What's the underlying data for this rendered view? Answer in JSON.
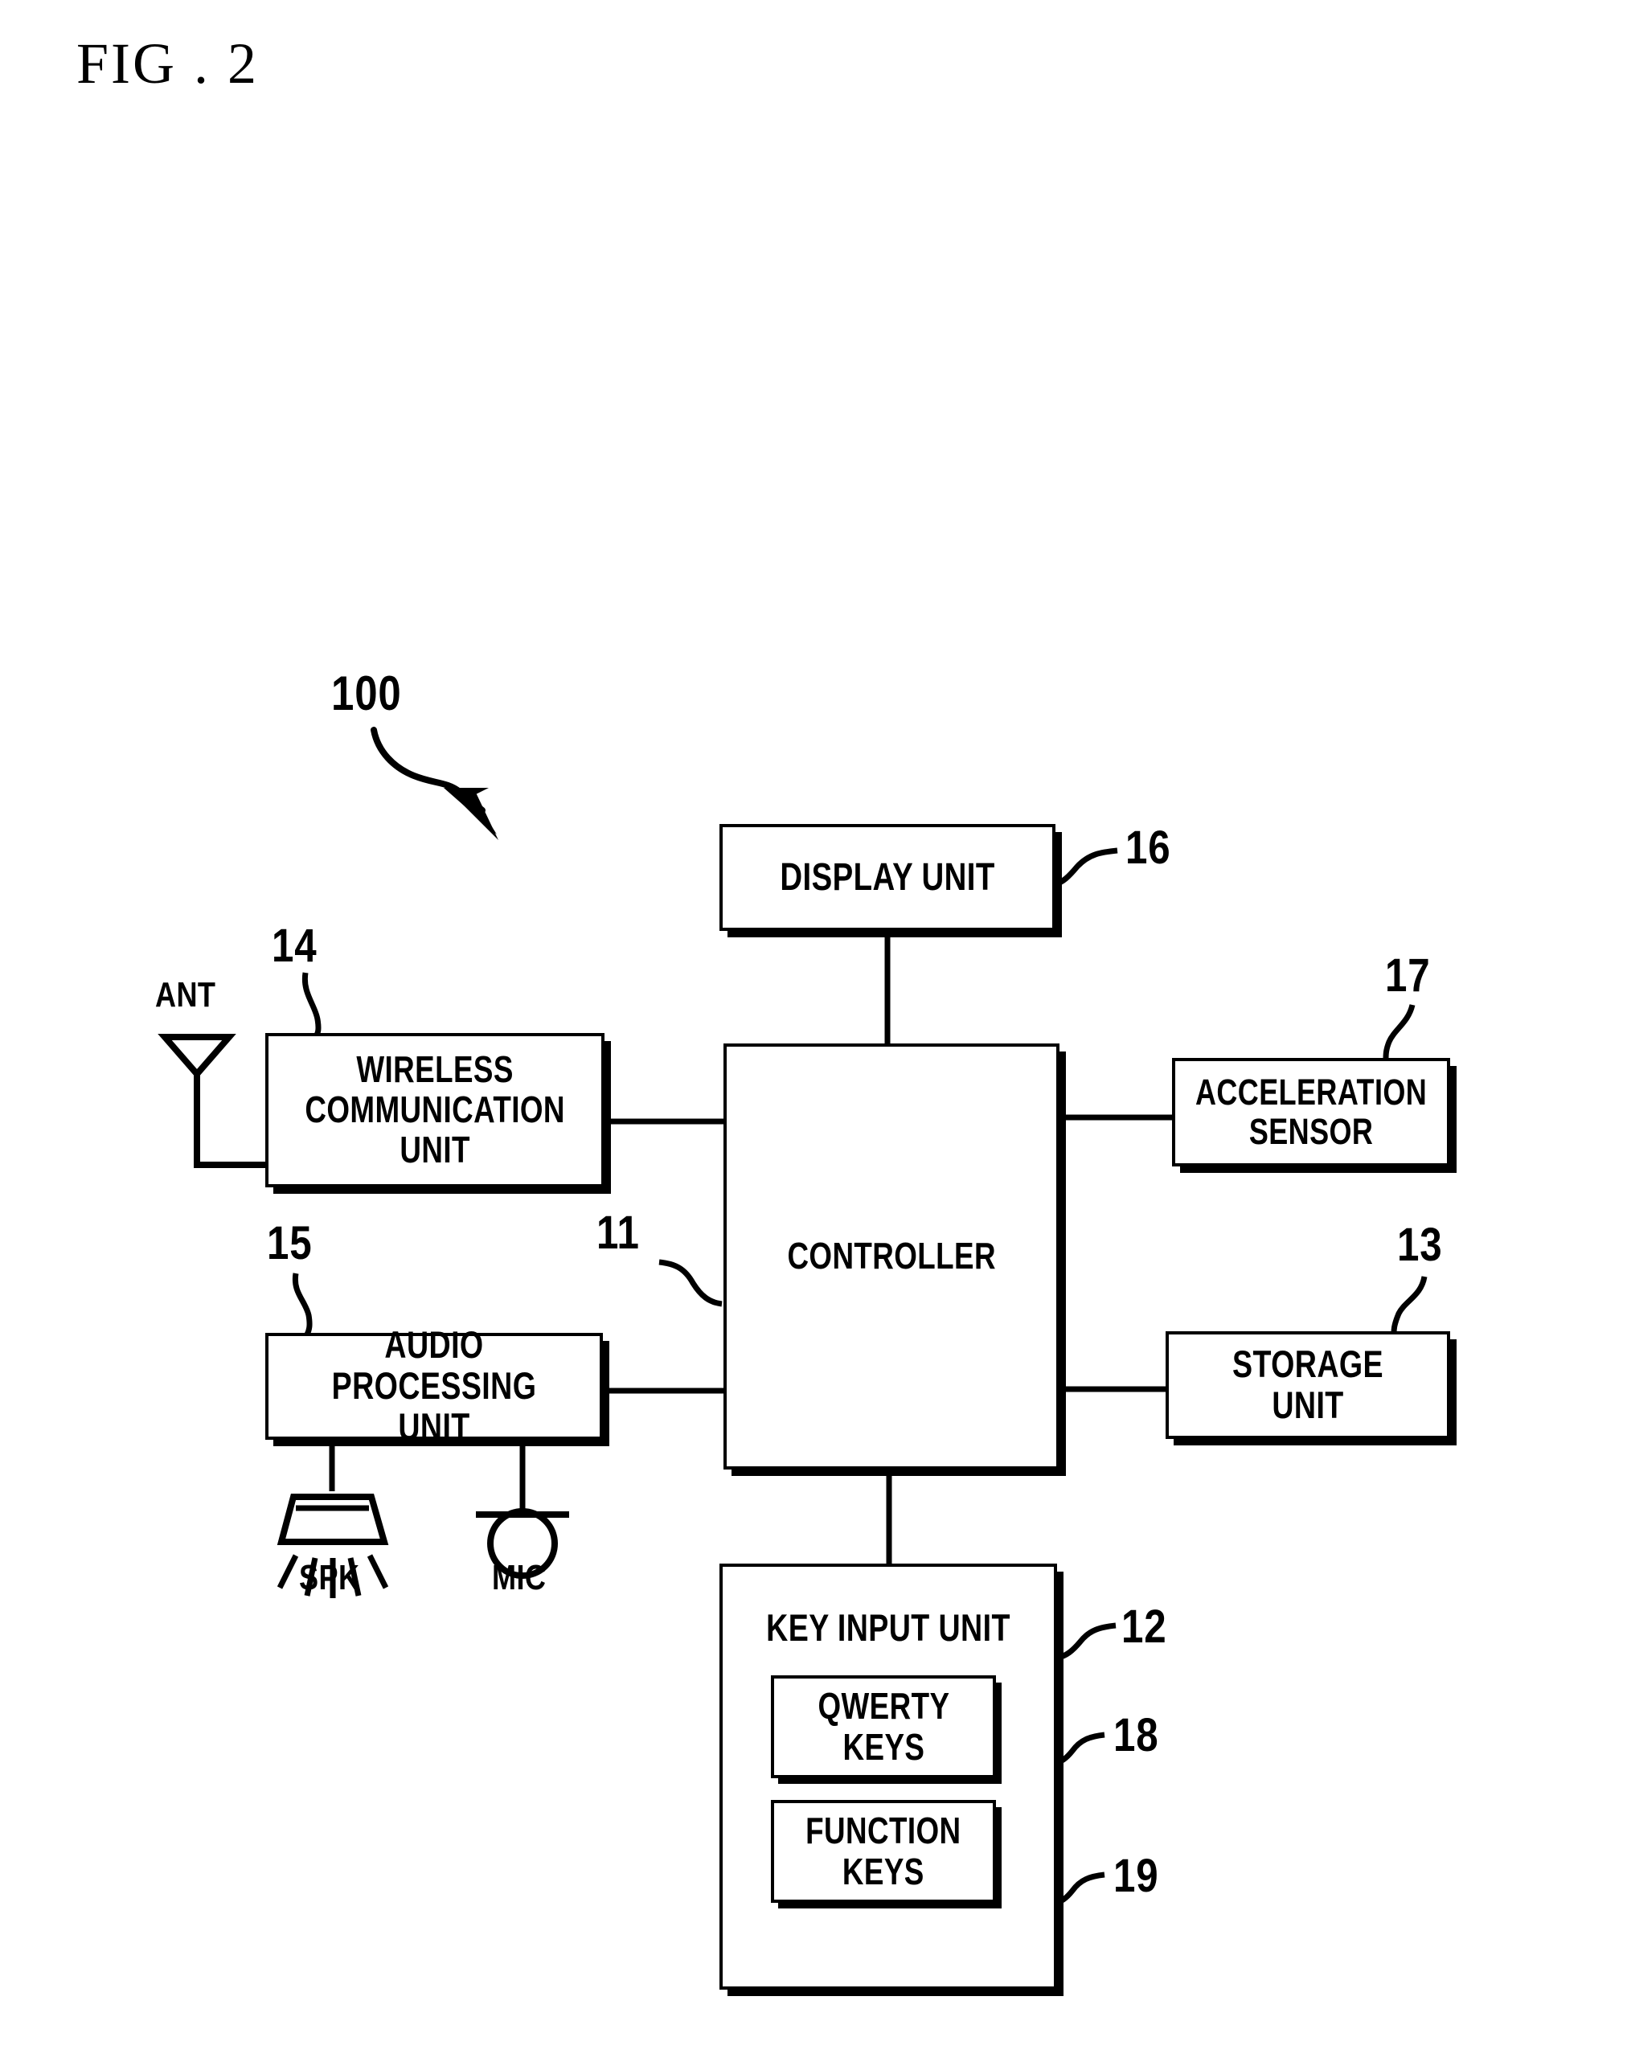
{
  "figure": {
    "title": "FIG . 2",
    "system_reference": "100"
  },
  "diagram": {
    "type": "block-diagram",
    "description": "Block diagram of a mobile terminal showing controller and peripheral units",
    "nodes": [
      {
        "id": "display",
        "label": "DISPLAY UNIT",
        "ref": "16"
      },
      {
        "id": "controller",
        "label": "CONTROLLER",
        "ref": "11"
      },
      {
        "id": "wireless",
        "label": "WIRELESS\nCOMMUNICATION\nUNIT",
        "ref": "14"
      },
      {
        "id": "audio",
        "label": "AUDIO\nPROCESSING UNIT",
        "ref": "15"
      },
      {
        "id": "accel",
        "label": "ACCELERATION\nSENSOR",
        "ref": "17"
      },
      {
        "id": "storage",
        "label": "STORAGE UNIT",
        "ref": "13"
      },
      {
        "id": "keyinput",
        "label": "KEY INPUT UNIT",
        "ref": "12"
      },
      {
        "id": "qwerty",
        "label": "QWERTY\nKEYS",
        "ref": "18"
      },
      {
        "id": "function",
        "label": "FUNCTION\nKEYS",
        "ref": "19"
      }
    ],
    "peripherals": [
      {
        "id": "antenna",
        "label": "ANT",
        "icon": "antenna-icon"
      },
      {
        "id": "speaker",
        "label": "SPK",
        "icon": "speaker-icon"
      },
      {
        "id": "microphone",
        "label": "MIC",
        "icon": "microphone-icon"
      }
    ],
    "connections": [
      {
        "from": "display",
        "to": "controller"
      },
      {
        "from": "wireless",
        "to": "controller"
      },
      {
        "from": "audio",
        "to": "controller"
      },
      {
        "from": "controller",
        "to": "accel"
      },
      {
        "from": "controller",
        "to": "storage"
      },
      {
        "from": "controller",
        "to": "keyinput"
      },
      {
        "from": "antenna",
        "to": "wireless"
      },
      {
        "from": "audio",
        "to": "speaker"
      },
      {
        "from": "audio",
        "to": "microphone"
      }
    ],
    "colors": {
      "line": "#000000",
      "fill": "#ffffff"
    }
  }
}
